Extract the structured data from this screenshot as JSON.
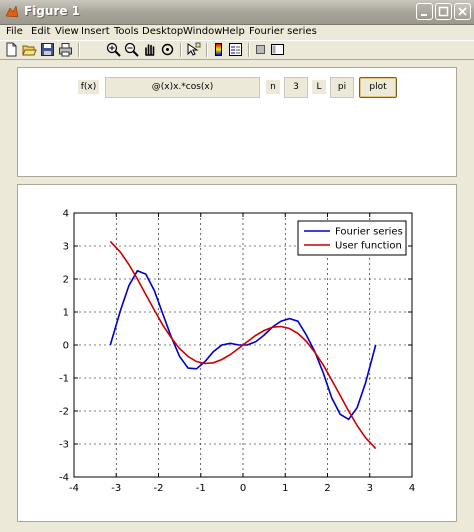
{
  "window": {
    "title": "Figure 1",
    "controls": [
      "minimize-icon",
      "maximize-icon",
      "close-icon"
    ]
  },
  "menu": [
    "File",
    "Edit",
    "View",
    "Insert",
    "Tools",
    "Desktop",
    "Window",
    "Help",
    "Fourier series"
  ],
  "toolbar": [
    "new-figure-icon",
    "open-icon",
    "save-icon",
    "print-icon",
    "zoom-in-icon",
    "zoom-out-icon",
    "pan-icon",
    "rotate-icon",
    "data-cursor-icon",
    "colorbar-icon",
    "legend-icon",
    "hide-plot-tools-icon",
    "show-plot-tools-icon"
  ],
  "controls": {
    "fx_label": "f(x)",
    "fx_value": "@(x)x.*cos(x)",
    "n_label": "n",
    "n_value": "3",
    "L_label": "L",
    "L_value": "pi",
    "plot_button": "plot"
  },
  "chart_data": {
    "type": "line",
    "xlim": [
      -4,
      4
    ],
    "ylim": [
      -4,
      4
    ],
    "xticks": [
      "-4",
      "-3",
      "-2",
      "-1",
      "0",
      "1",
      "2",
      "3",
      "4"
    ],
    "yticks": [
      "4",
      "3",
      "2",
      "1",
      "0",
      "-1",
      "-2",
      "-3",
      "-4"
    ],
    "grid": true,
    "legend_placement": "top-right",
    "series": [
      {
        "name": "Fourier series",
        "color": "#0000cc",
        "x": [
          -3.14,
          -2.9,
          -2.7,
          -2.5,
          -2.3,
          -2.1,
          -1.9,
          -1.7,
          -1.5,
          -1.3,
          -1.1,
          -0.9,
          -0.7,
          -0.5,
          -0.3,
          -0.1,
          0.1,
          0.3,
          0.5,
          0.7,
          0.9,
          1.1,
          1.3,
          1.5,
          1.7,
          1.9,
          2.1,
          2.3,
          2.5,
          2.7,
          2.9,
          3.14
        ],
        "y": [
          0.0,
          1.05,
          1.8,
          2.25,
          2.15,
          1.65,
          0.95,
          0.25,
          -0.35,
          -0.7,
          -0.72,
          -0.5,
          -0.2,
          0.0,
          0.05,
          0.0,
          0.0,
          0.1,
          0.3,
          0.55,
          0.72,
          0.8,
          0.72,
          0.3,
          -0.2,
          -0.85,
          -1.6,
          -2.1,
          -2.25,
          -1.9,
          -1.15,
          0.0
        ]
      },
      {
        "name": "User function",
        "color": "#cc0000",
        "x": [
          -3.14,
          -2.9,
          -2.7,
          -2.5,
          -2.3,
          -2.1,
          -1.9,
          -1.7,
          -1.5,
          -1.3,
          -1.1,
          -0.9,
          -0.7,
          -0.5,
          -0.3,
          -0.1,
          0.1,
          0.3,
          0.5,
          0.7,
          0.9,
          1.1,
          1.3,
          1.5,
          1.7,
          1.9,
          2.1,
          2.3,
          2.5,
          2.7,
          2.9,
          3.14
        ],
        "y": [
          3.14,
          2.81,
          2.44,
          2.0,
          1.53,
          1.06,
          0.61,
          0.22,
          -0.11,
          -0.35,
          -0.5,
          -0.56,
          -0.54,
          -0.44,
          -0.29,
          -0.1,
          0.1,
          0.29,
          0.44,
          0.54,
          0.56,
          0.5,
          0.35,
          0.11,
          -0.22,
          -0.61,
          -1.06,
          -1.53,
          -2.0,
          -2.44,
          -2.81,
          -3.14
        ]
      }
    ]
  }
}
